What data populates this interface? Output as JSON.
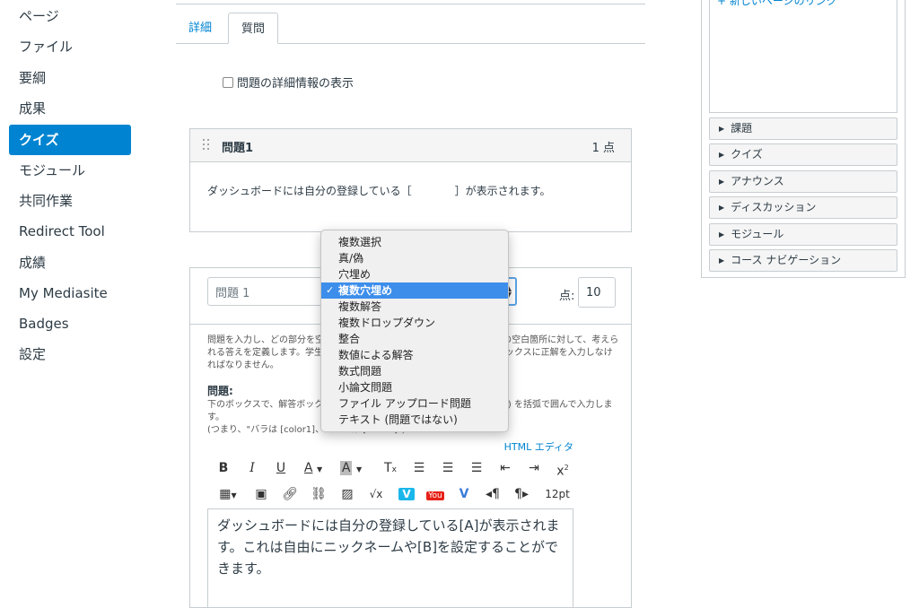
{
  "sidebar": {
    "items": [
      {
        "label": "ページ",
        "active": false
      },
      {
        "label": "ファイル",
        "active": false
      },
      {
        "label": "要綱",
        "active": false
      },
      {
        "label": "成果",
        "active": false
      },
      {
        "label": "クイズ",
        "active": true
      },
      {
        "label": "モジュール",
        "active": false
      },
      {
        "label": "共同作業",
        "active": false
      },
      {
        "label": "Redirect Tool",
        "active": false
      },
      {
        "label": "成績",
        "active": false
      },
      {
        "label": "My Mediasite",
        "active": false
      },
      {
        "label": "Badges",
        "active": false
      },
      {
        "label": "設定",
        "active": false
      }
    ],
    "accent_color": "#0084d1"
  },
  "tabs": {
    "details": "詳細",
    "questions": "質問"
  },
  "show_details_label": "問題の詳細情報の表示",
  "question1": {
    "title": "問題1",
    "points": "1 点",
    "body": "ダッシュボードには自分の登録している［　　　　］が表示されます。"
  },
  "question_edit": {
    "name_value": "問題 1",
    "points_label": "点:",
    "points_value": "10",
    "instructions": "問題を入力し、どの部分を空白にするかを指定します。その後、それぞれの空白箇所に対して、考えられる答えを定義します。学生は、各空白箇所の横に表示されるテキスト ボックスに正解を入力しなければなりません。",
    "question_label": "問題:",
    "instructions2_line1": "下のボックスで、解答ボックスを表示したい場所に変数名を (スペースなし) を括弧で囲んで入力します。",
    "instructions2_line2": "(つまり、\"バラは [color1]、スミレは [color2]\")",
    "html_editor_link": "HTML エディタ",
    "editor_text": "ダッシュボードには自分の登録している[A]が表示されます。これは自由にニックネームや[B]を設定することができます。",
    "font_size": "12pt"
  },
  "type_dropdown": {
    "options": [
      "複数選択",
      "真/偽",
      "穴埋め",
      "複数穴埋め",
      "複数解答",
      "複数ドロップダウン",
      "整合",
      "数値による解答",
      "数式問題",
      "小論文問題",
      "ファイル アップロード問題",
      "テキスト (問題ではない)"
    ],
    "selected_index": 3,
    "selected_color": "#3d8eeb"
  },
  "right_panel": {
    "link_text": "新しいページのリンク",
    "sections": [
      "課題",
      "クイズ",
      "アナウンス",
      "ディスカッション",
      "モジュール",
      "コース ナビゲーション"
    ]
  },
  "toolbar_icons": [
    "bold-icon",
    "italic-icon",
    "underline-icon",
    "font-color-icon",
    "background-color-icon",
    "clear-formatting-icon",
    "align-left-icon",
    "align-center-icon",
    "align-right-icon",
    "outdent-icon",
    "indent-icon",
    "superscript-icon",
    "table-icon",
    "media-icon",
    "link-icon",
    "unlink-icon",
    "image-icon",
    "equation-icon",
    "vimeo-icon",
    "youtube-icon",
    "vimeo-alt-icon",
    "ltr-icon",
    "rtl-icon"
  ]
}
